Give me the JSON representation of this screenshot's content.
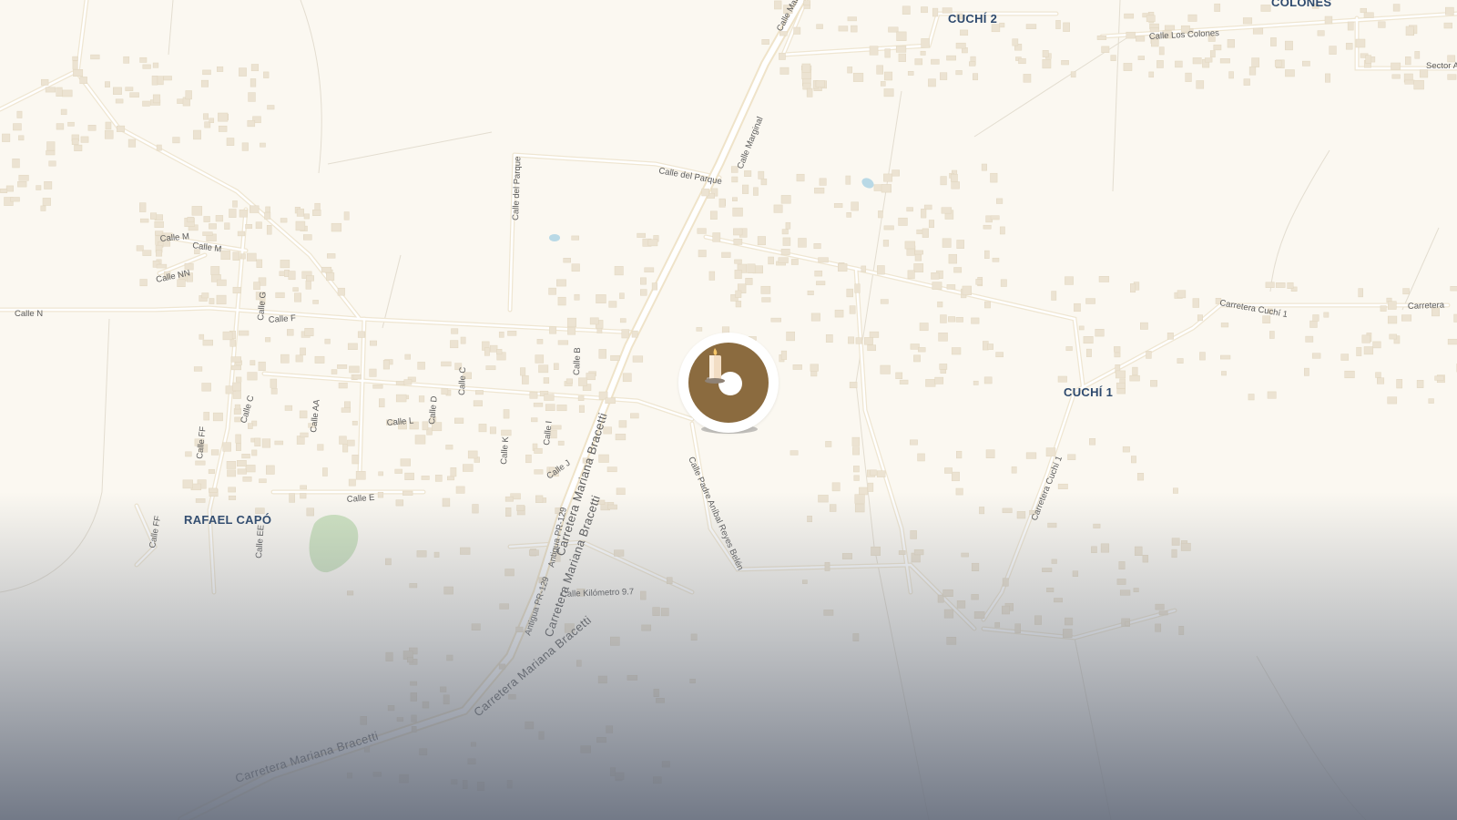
{
  "map": {
    "place_labels": {
      "cuchi2": "CUCHÍ 2",
      "colones": "COLONES",
      "cuchi1": "CUCHÍ 1",
      "rafael_capo": "RAFAEL CAPÓ"
    },
    "street_labels": {
      "calle_marginal_top": "Calle Mar",
      "calle_los_colones": "Calle Los Colones",
      "sector": "Sector A",
      "calle_marginal": "Calle Marginal",
      "calle_del_parque_h": "Calle del Parque",
      "calle_del_parque_v": "Calle del Parque",
      "calle_m1": "Calle M",
      "calle_m2": "Calle M",
      "calle_nn": "Calle NN",
      "calle_n": "Calle N",
      "calle_g": "Calle G",
      "calle_f": "Calle F",
      "calle_b": "Calle B",
      "calle_c1": "Calle C",
      "calle_c2": "Calle C",
      "calle_aa": "Calle AA",
      "calle_d": "Calle D",
      "calle_l": "Calle L",
      "calle_ff1": "Calle FF",
      "calle_ff2": "Calle FF",
      "calle_k": "Calle K",
      "calle_i": "Calle I",
      "calle_j": "Calle J",
      "calle_e": "Calle E",
      "calle_ee": "Calle EE",
      "antigua_pr129_1": "Antigua PR-129",
      "antigua_pr129_2": "Antigua PR-129",
      "calle_km": "Calle Kilómetro 9.7",
      "calle_padre": "Calle Padre Aníbal Reyes Belén",
      "carretera_cuchi1_a": "Carretera Cuchí 1",
      "carretera_cuchi1_b": "Carretera",
      "carretera_cuchi1_v": "Carretera Cuchí 1"
    },
    "highway_labels": {
      "bracetti_1": "Carretera Mariana Bracetti",
      "bracetti_2": "Carretera Mariana Bracetti",
      "bracetti_3": "Carretera Mariana Bracetti",
      "bracetti_4": "Carretera Mariana Bracetti"
    },
    "colors": {
      "land": "#fbf8f1",
      "road": "#ffffff",
      "road_casing": "#efe6d2",
      "building": "#e8ddc8",
      "water": "#b9d9e6",
      "park": "#cfe3c2",
      "place_label": "#2e4a6e",
      "marker": "#8b6b3f"
    },
    "marker": {
      "icon": "candle-icon"
    }
  }
}
